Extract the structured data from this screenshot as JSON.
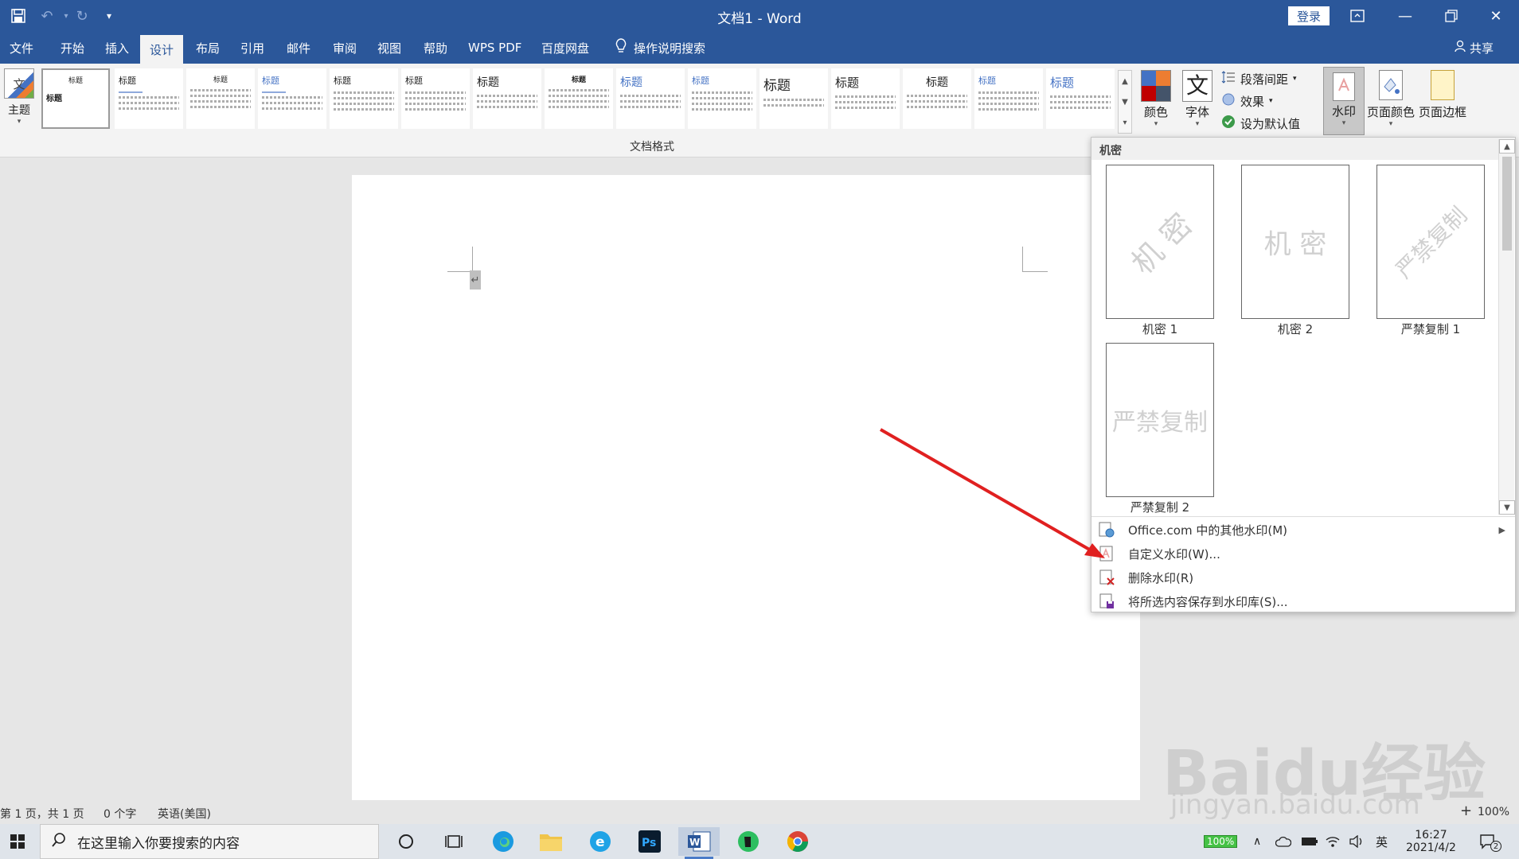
{
  "window": {
    "title": "文档1  -  Word",
    "login_label": "登录"
  },
  "tabs": [
    {
      "label": "文件"
    },
    {
      "label": "开始"
    },
    {
      "label": "插入"
    },
    {
      "label": "设计"
    },
    {
      "label": "布局"
    },
    {
      "label": "引用"
    },
    {
      "label": "邮件"
    },
    {
      "label": "审阅"
    },
    {
      "label": "视图"
    },
    {
      "label": "帮助"
    },
    {
      "label": "WPS PDF"
    },
    {
      "label": "百度网盘"
    }
  ],
  "tell_me": "操作说明搜索",
  "share": "共享",
  "ribbon": {
    "themes_label": "主题",
    "styles_group_label": "文档格式",
    "style_thumb_title": "标题",
    "colors_label": "颜色",
    "fonts_label": "字体",
    "font_glyph": "文",
    "paragraph_spacing": "段落间距",
    "effects": "效果",
    "set_default": "设为默认值",
    "watermark": "水印",
    "page_color": "页面颜色",
    "page_borders": "页面边框"
  },
  "dropdown": {
    "section_header": "机密",
    "items": [
      {
        "label": "机密 1",
        "text": "机 密"
      },
      {
        "label": "机密 2",
        "text": "机 密"
      },
      {
        "label": "严禁复制 1",
        "text": "严禁复制"
      },
      {
        "label": "严禁复制 2",
        "text": "严禁复制"
      }
    ],
    "menu": [
      {
        "label": "Office.com 中的其他水印(M)"
      },
      {
        "label": "自定义水印(W)..."
      },
      {
        "label": "删除水印(R)"
      },
      {
        "label": "将所选内容保存到水印库(S)..."
      }
    ]
  },
  "statusbar": {
    "page": "第 1 页，共 1 页",
    "words": "0 个字",
    "language": "英语(美国)",
    "zoom": "100%"
  },
  "taskbar": {
    "search_placeholder": "在这里输入你要搜索的内容",
    "battery": "100%",
    "ime": "英",
    "time": "16:27",
    "date": "2021/4/2",
    "notifications": "2"
  },
  "page_watermark": {
    "brand": "Baidu经验",
    "url": "jingyan.baidu.com"
  },
  "colors": {
    "word_blue": "#2b579a",
    "arrow_red": "#e02020"
  }
}
